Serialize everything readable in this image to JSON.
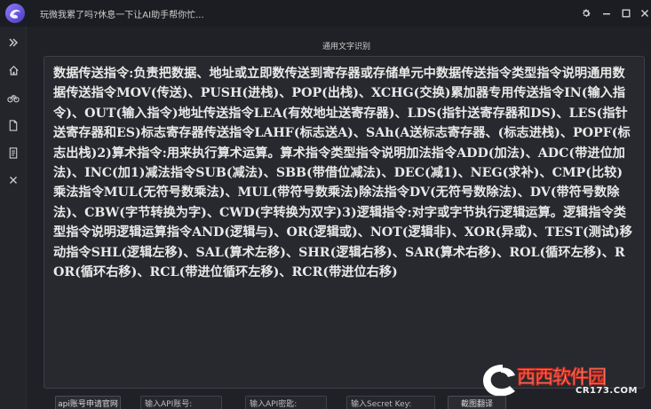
{
  "window": {
    "title": "玩微我累了吗?休息一下让AI助手帮你忙..."
  },
  "main": {
    "title": "通用文字识别",
    "ocr_text": "数据传送指令:负责把数据、地址或立即数传送到寄存器或存储单元中数据传送指令类型指令说明通用数据传送指令MOV(传送)、PUSH(进栈)、POP(出栈)、XCHG(交换)累加器专用传送指令IN(输入指令)、OUT(输入指令)地址传送指令LEA(有效地址送寄存器)、LDS(指针送寄存器和DS)、LES(指针送寄存器和ES)标志寄存器传送指令LAHF(标志送A)、SAh(A送标志寄存器、(标志进栈)、POPF(标志出栈)2)算术指令:用来执行算术运算。算术指令类型指令说明加法指令ADD(加法)、ADC(带进位加法)、INC(加1)减法指令SUB(减法)、SBB(带借位减法)、DEC(减1)、NEG(求补)、CMP(比较)乘法指令MUL(无符号数乘法)、MUL(带符号数乘法)除法指令DV(无符号数除法)、DV(带符号数除法)、CBW(字节转换为字)、CWD(字转换为双字)3)逻辑指令:对字或字节执行逻辑运算。逻辑指令类型指令说明逻辑运算指令AND(逻辑与)、OR(逻辑或)、NOT(逻辑非)、XOR(异或)、TEST(测试)移动指令SHL(逻辑左移)、SAL(算术左移)、SHR(逻辑右移)、SAR(算术右移)、ROL(循环左移)、ROR(循环右移)、RCL(带进位循环左移)、RCR(带进位右移)"
  },
  "bottom": {
    "apply_button": "api账号申请官网",
    "api_account_label": "输入API账号:",
    "api_key_label": "输入API密匙:",
    "secret_key_label": "输入Secret Key:",
    "translate_button": "截图翻译"
  },
  "watermark": {
    "brand": "西西软件园",
    "url": "CR173.COM"
  },
  "colors": {
    "background": "#1f2126",
    "panel": "#27292f",
    "text": "#e9e9e9",
    "watermark_orange": "#f08a1c",
    "watermark_red": "#e0301e"
  },
  "icons": {
    "logo": "app-logo-icon",
    "settings": "gear-icon",
    "minimize": "minimize-icon",
    "maximize": "maximize-icon",
    "close": "close-icon",
    "sidebar": [
      "expand-icon",
      "home-icon",
      "bike-icon",
      "document-icon",
      "notes-icon",
      "close-icon"
    ]
  }
}
